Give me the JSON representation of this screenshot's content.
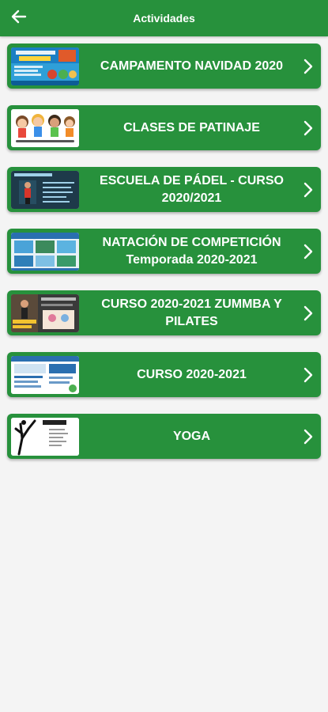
{
  "header": {
    "title": "Actividades",
    "back_icon": "arrow-left-icon"
  },
  "colors": {
    "primary": "#27913c",
    "background": "#f4f4f4",
    "text_on_primary": "#ffffff"
  },
  "activities": [
    {
      "label": "CAMPAMENTO NAVIDAD 2020",
      "thumbnail": "campamento-navidad-poster"
    },
    {
      "label": "CLASES DE PATINAJE",
      "thumbnail": "kids-skating-illustration"
    },
    {
      "label": "ESCUELA DE PÁDEL - CURSO\n2020/2021",
      "thumbnail": "padel-school-poster"
    },
    {
      "label": "NATACIÓN DE COMPETICIÓN\nTemporada 2020-2021",
      "thumbnail": "swimming-competition-poster"
    },
    {
      "label": "CURSO 2020-2021 ZUMMBA Y\nPILATES",
      "thumbnail": "zumba-pilates-poster"
    },
    {
      "label": "CURSO 2020-2021",
      "thumbnail": "course-info-poster"
    },
    {
      "label": "YOGA",
      "thumbnail": "yoga-poster"
    }
  ]
}
